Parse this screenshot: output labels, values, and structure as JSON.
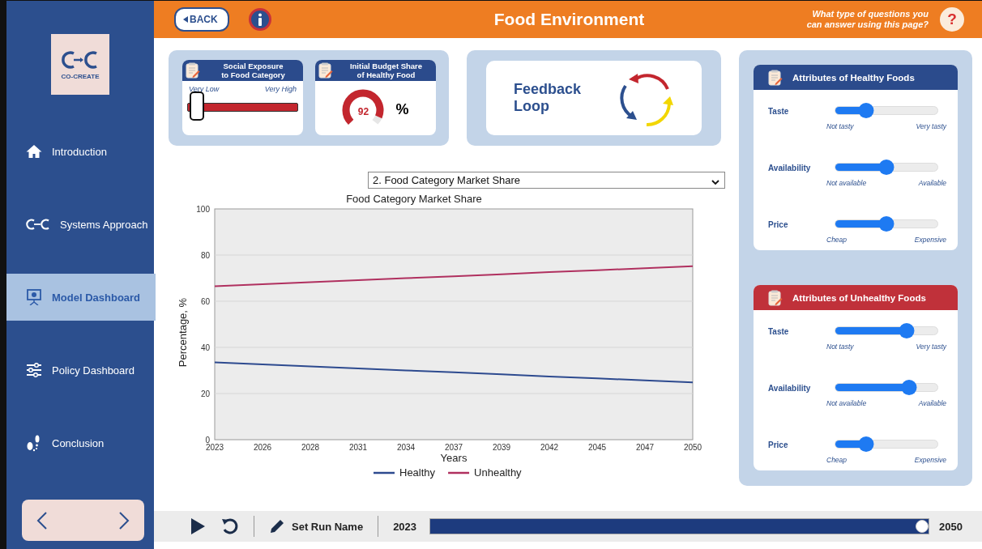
{
  "sidebar": {
    "logo_text": "CO-CREATE",
    "nav": [
      {
        "label": "Introduction",
        "selected": false
      },
      {
        "label": "Systems Approach",
        "selected": false
      },
      {
        "label": "Model Dashboard",
        "selected": true
      },
      {
        "label": "Policy Dashboard",
        "selected": false
      },
      {
        "label": "Conclusion",
        "selected": false
      }
    ]
  },
  "header": {
    "back": "BACK",
    "title": "Food Environment",
    "help_lines": [
      "What type of questions you",
      "can answer using this page?"
    ],
    "help_mark": "?"
  },
  "inputs": {
    "social_exposure": {
      "title_lines": [
        "Social Exposure",
        "to Food Category"
      ],
      "min_label": "Very Low",
      "max_label": "Very High",
      "level": 0.08
    },
    "budget_share": {
      "title_lines": [
        "Initial Budget Share",
        "of Healthy Food"
      ],
      "value": "92",
      "unit": "%",
      "level": 0.92
    }
  },
  "feedback_loop": {
    "label_lines": [
      "Feedback",
      "Loop"
    ]
  },
  "attribute_panels": [
    {
      "title": "Attributes of Healthy Foods",
      "color": "#2b4b8c",
      "sliders": [
        {
          "label": "Taste",
          "min_label": "Not tasty",
          "max_label": "Very tasty",
          "level": 0.3
        },
        {
          "label": "Availability",
          "min_label": "Not available",
          "max_label": "Available",
          "level": 0.5
        },
        {
          "label": "Price",
          "min_label": "Cheap",
          "max_label": "Expensive",
          "level": 0.5
        }
      ]
    },
    {
      "title": "Attributes of Unhealthy Foods",
      "color": "#c0313a",
      "sliders": [
        {
          "label": "Taste",
          "min_label": "Not tasty",
          "max_label": "Very tasty",
          "level": 0.7
        },
        {
          "label": "Availability",
          "min_label": "Not available",
          "max_label": "Available",
          "level": 0.72
        },
        {
          "label": "Price",
          "min_label": "Cheap",
          "max_label": "Expensive",
          "level": 0.3
        }
      ]
    }
  ],
  "chart_selector": {
    "value": "2. Food Category Market Share"
  },
  "chart": {
    "chart_data": {
      "type": "line",
      "title": "Food Category Market Share",
      "xlabel": "Years",
      "ylabel": "Percentage, %",
      "categories": [
        "2023",
        "2026",
        "2028",
        "2031",
        "2034",
        "2037",
        "2039",
        "2042",
        "2045",
        "2047",
        "2050"
      ],
      "series": [
        {
          "name": "Healthy",
          "color": "#2d4a8f",
          "values": [
            33.5,
            32.6,
            31.8,
            30.9,
            30.0,
            29.2,
            28.3,
            27.4,
            26.6,
            25.7,
            24.8
          ]
        },
        {
          "name": "Unhealthy",
          "color": "#b0305f",
          "values": [
            66.5,
            67.4,
            68.2,
            69.1,
            70.0,
            70.8,
            71.7,
            72.6,
            73.4,
            74.3,
            75.2
          ]
        }
      ],
      "ylim": [
        0,
        100
      ],
      "yticks": [
        0,
        20,
        40,
        60,
        80,
        100
      ],
      "grid": true,
      "legend": "bottom"
    }
  },
  "run_bar": {
    "run_name": "Set Run Name",
    "start": "2023",
    "end": "2050",
    "level": 1
  }
}
